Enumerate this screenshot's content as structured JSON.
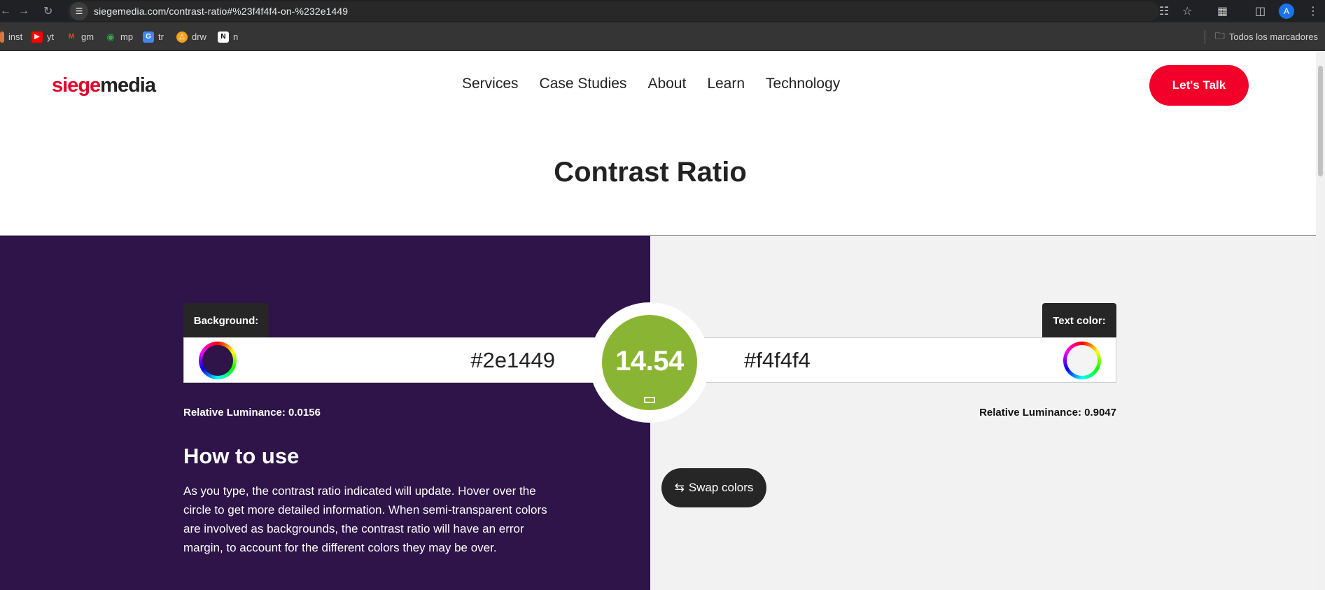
{
  "browser": {
    "url": "siegemedia.com/contrast-ratio#%23f4f4f4-on-%232e1449",
    "profile_initial": "A",
    "bookmarks": [
      {
        "label": "inst",
        "icon": "instagram-icon"
      },
      {
        "label": "yt",
        "icon": "youtube-icon"
      },
      {
        "label": "gm",
        "icon": "gmail-icon"
      },
      {
        "label": "mp",
        "icon": "maps-icon"
      },
      {
        "label": "tr",
        "icon": "translate-icon"
      },
      {
        "label": "drw",
        "icon": "drive-icon"
      },
      {
        "label": "n",
        "icon": "notion-icon"
      }
    ],
    "all_bookmarks_label": "Todos los marcadores"
  },
  "site": {
    "logo_part1": "siege",
    "logo_part2": "media",
    "nav": [
      "Services",
      "Case Studies",
      "About",
      "Learn",
      "Technology"
    ],
    "cta_label": "Let's Talk",
    "accent_color": "#f2002a"
  },
  "tool": {
    "title": "Contrast Ratio",
    "background_label": "Background:",
    "background_value": "#2e1449",
    "background_color": "#2e1449",
    "text_label": "Text color:",
    "text_value": "#f4f4f4",
    "text_color": "#f4f4f4",
    "ratio": "14.54",
    "ratio_color": "#8ab534",
    "bg_luminance": "Relative Luminance: 0.0156",
    "fg_luminance": "Relative Luminance: 0.9047",
    "swap_label": "Swap colors",
    "how_title": "How to use",
    "how_body": "As you type, the contrast ratio indicated will update. Hover over the circle to get more detailed information. When semi-transparent colors are involved as backgrounds, the contrast ratio will have an error margin, to account for the different colors they may be over."
  }
}
